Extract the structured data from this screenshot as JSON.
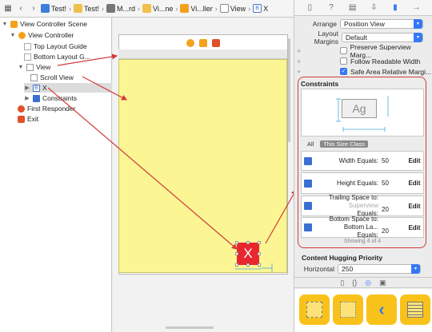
{
  "jumpbar": {
    "crumbs": [
      "Test!",
      "Test!",
      "M...rd",
      "Vi...ne",
      "Vi...ller",
      "View",
      "X"
    ]
  },
  "outline": {
    "scene_title": "View Controller Scene",
    "vc": "View Controller",
    "top_guide": "Top Layout Guide",
    "bottom_guide": "Bottom Layout G...",
    "view": "View",
    "scroll_view": "Scroll View",
    "x": "X",
    "constraints": "Constraints",
    "first_responder": "First Responder",
    "exit": "Exit",
    "b_glyph": "B"
  },
  "canvas": {
    "button_label": "X"
  },
  "inspector": {
    "arrange_label": "Arrange",
    "arrange_value": "Position View",
    "layout_margins_label": "Layout Margins",
    "layout_margins_value": "Default",
    "checks": [
      {
        "label": "Preserve Superview Marg...",
        "checked": false
      },
      {
        "label": "Follow Readable Width",
        "checked": false
      },
      {
        "label": "Safe Area Relative Margi...",
        "checked": true
      }
    ],
    "constraints_title": "Constraints",
    "preview_text": "Ag",
    "filter_all": "All",
    "filter_class": "This Size Class",
    "constraints": [
      {
        "label": "Width Equals:",
        "sub": "",
        "value": "50",
        "edit": "Edit"
      },
      {
        "label": "Height Equals:",
        "sub": "",
        "value": "50",
        "edit": "Edit"
      },
      {
        "label": "Trailing Space to:",
        "sub": "Superview",
        "label2": "Equals:",
        "value": "20",
        "edit": "Edit"
      },
      {
        "label": "Bottom Space to:",
        "sub": "Bottom La...",
        "label2": "Equals:",
        "value": "20",
        "edit": "Edit"
      }
    ],
    "showing": "Showing 4 of 4",
    "hugging_title": "Content Hugging Priority",
    "horizontal_label": "Horizontal",
    "horizontal_value": "250"
  },
  "colors": {
    "accent": "#3478f6",
    "canvas_yellow": "#fbf593",
    "button_red": "#e8272e",
    "annotation_red": "#d23b3b"
  }
}
